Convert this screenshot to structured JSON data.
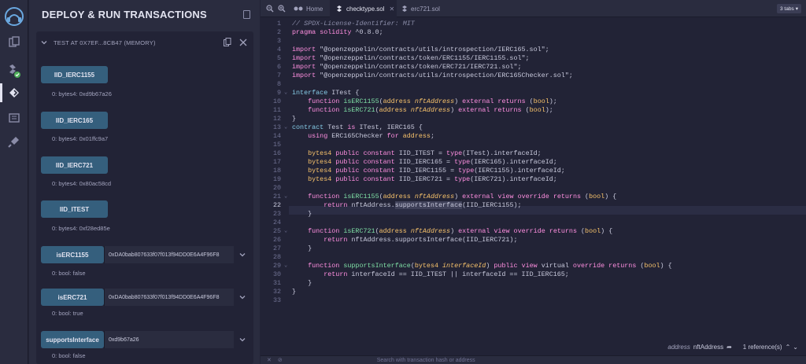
{
  "panel": {
    "title": "DEPLOY & RUN TRANSACTIONS",
    "instance_title": "TEST AT 0X7EF...8CB47 (MEMORY)"
  },
  "functions": [
    {
      "label": "IID_IERC1155",
      "output": "0: bytes4: 0xd9b67a26"
    },
    {
      "label": "IID_IERC165",
      "output": "0: bytes4: 0x01ffc9a7"
    },
    {
      "label": "IID_IERC721",
      "output": "0: bytes4: 0x80ac58cd"
    },
    {
      "label": "IID_ITEST",
      "output": "0: bytes4: 0xf28ed85e"
    },
    {
      "label": "isERC1155",
      "input": "0xDA0bab807633f07f013f94DD0E6A4F96F8",
      "output": "0: bool: false"
    },
    {
      "label": "isERC721",
      "input": "0xDA0bab807633f07f013f94DD0E6A4F96F8",
      "output": "0: bool: true"
    },
    {
      "label": "supportsInterface",
      "input": "0xd9b67a26",
      "output": "0: bool: false"
    }
  ],
  "editor": {
    "tabs": [
      {
        "label": "Home",
        "icon": "home-icon"
      },
      {
        "label": "checktype.sol",
        "icon": "solidity-icon"
      },
      {
        "label": "erc721.sol",
        "icon": "solidity-icon"
      }
    ],
    "tabs_count": "3 tabs",
    "status": {
      "symbol_kind": "address",
      "symbol_name": "nftAddress",
      "references": "1 reference(s)"
    },
    "terminal_placeholder": "Search with transaction hash or address"
  },
  "colors": {
    "button": "#355f7d",
    "panel_bg": "#2a2c3f",
    "editor_bg": "#222336",
    "keyword": "#ff8fe0",
    "function": "#7fe0a6",
    "type": "#f7c26b"
  }
}
